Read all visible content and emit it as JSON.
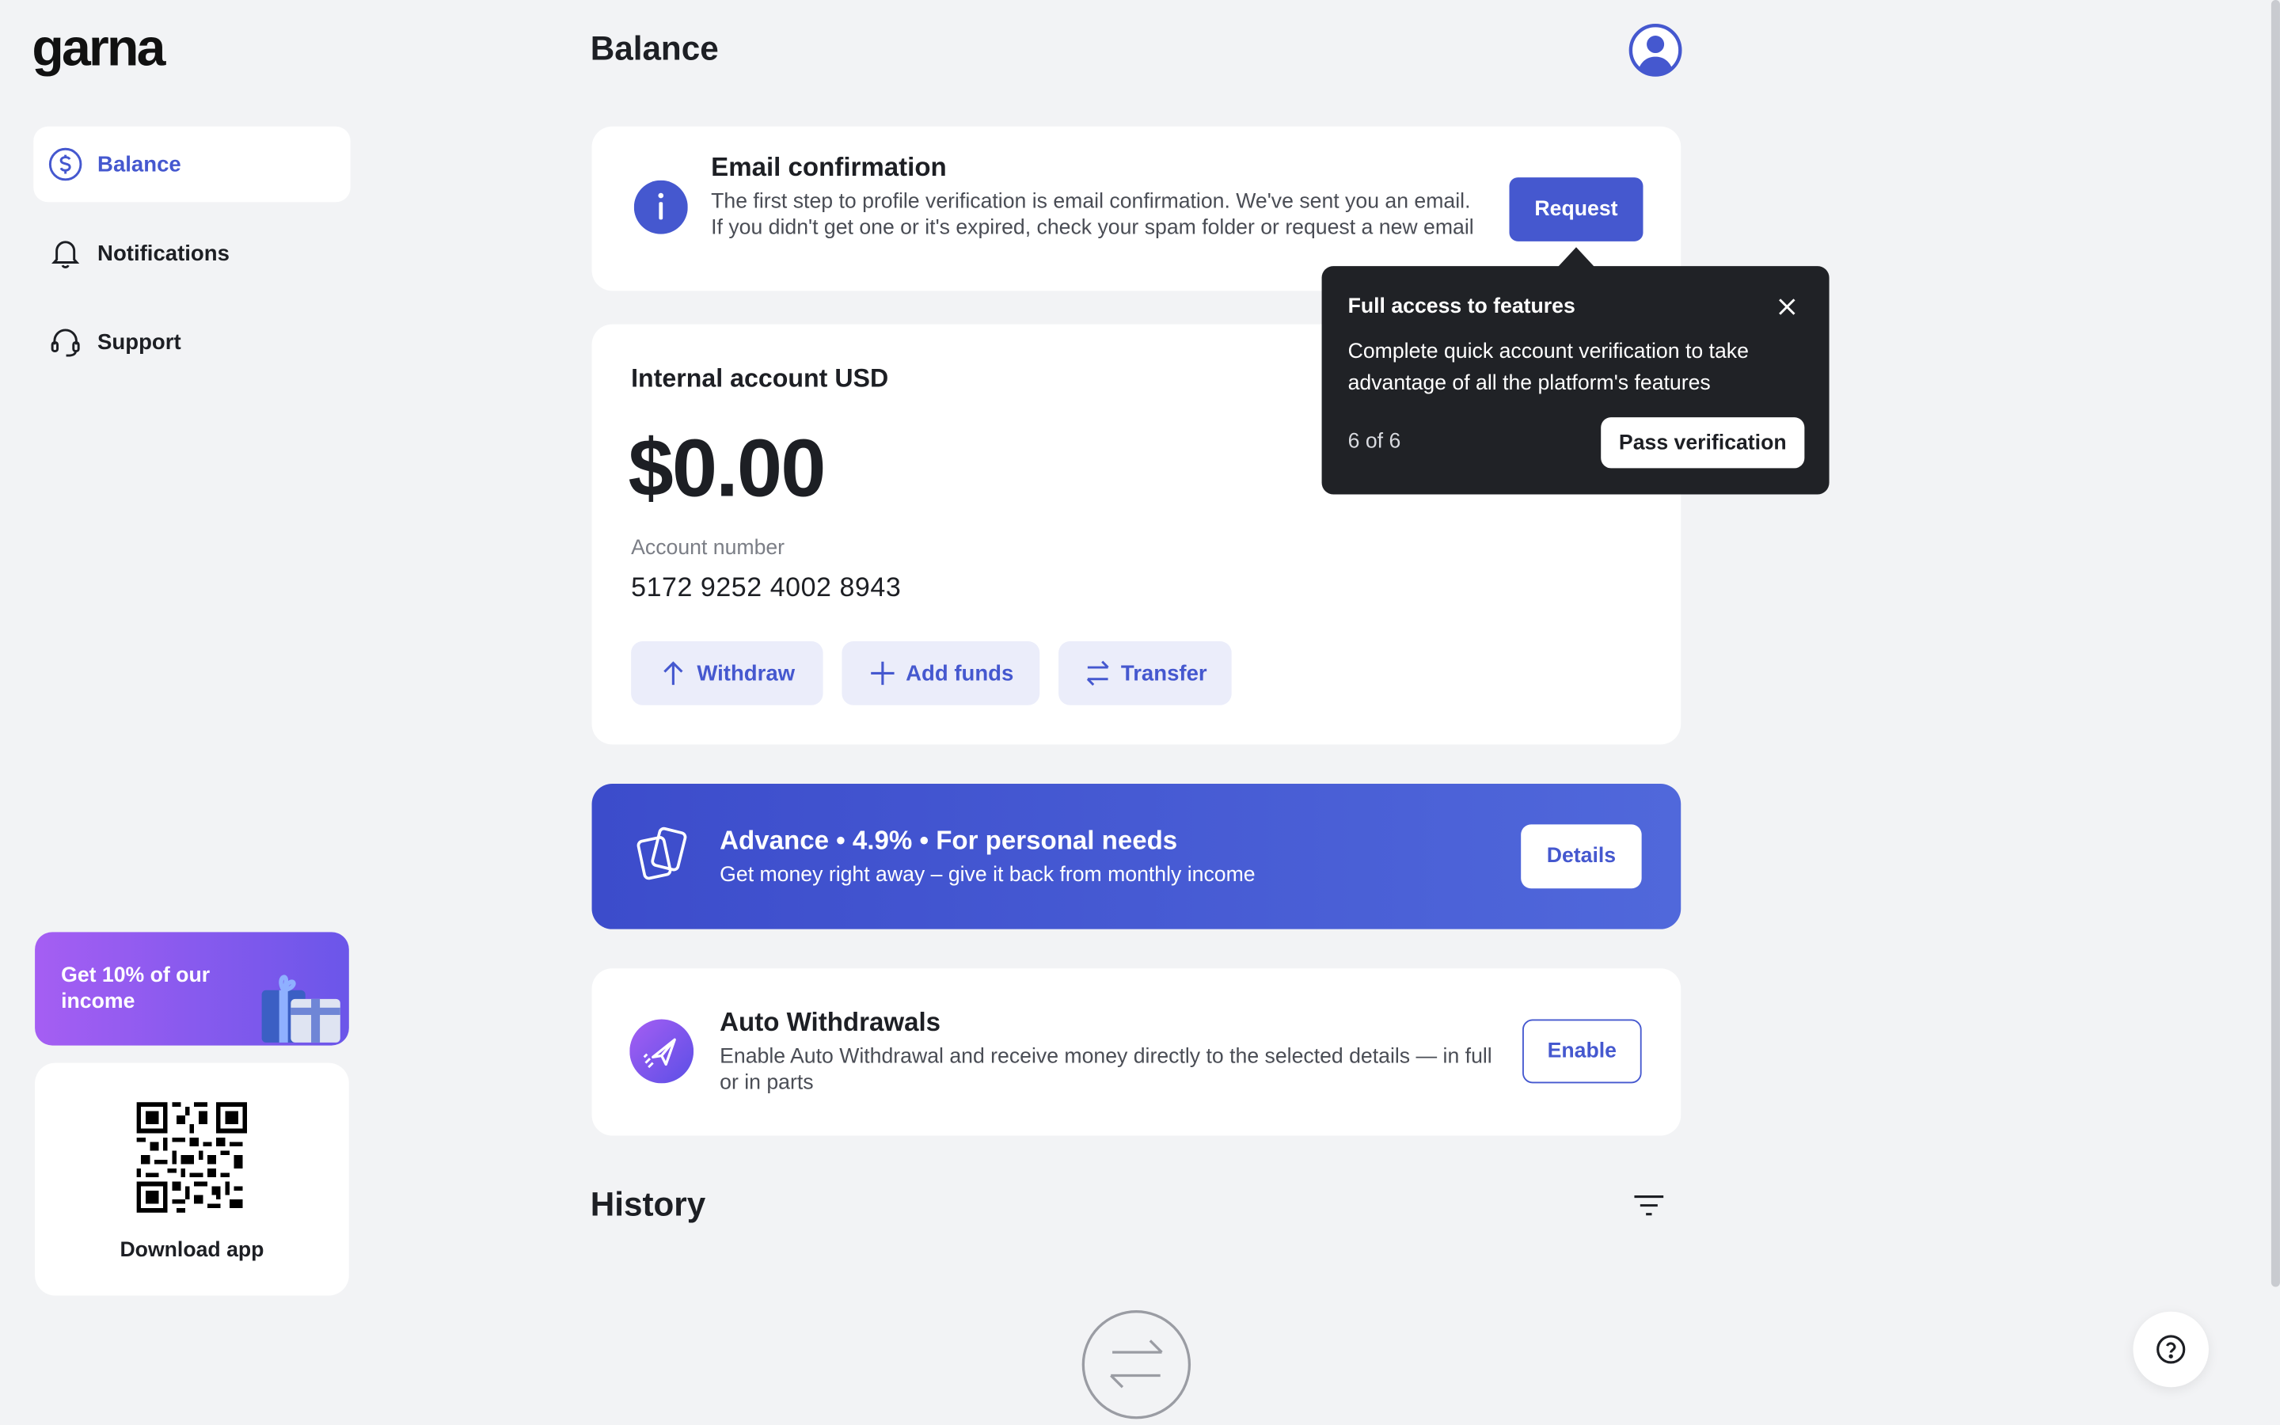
{
  "app": {
    "logo": "garna",
    "page_title": "Balance"
  },
  "sidebar": {
    "items": [
      {
        "label": "Balance",
        "icon": "dollar-circle-icon",
        "active": true
      },
      {
        "label": "Notifications",
        "icon": "bell-icon",
        "active": false
      },
      {
        "label": "Support",
        "icon": "headset-icon",
        "active": false
      }
    ],
    "promo": {
      "text": "Get 10% of our income",
      "icon": "gift-icon"
    },
    "download": {
      "label": "Download app",
      "icon": "qr-code-icon"
    }
  },
  "email_confirmation": {
    "title": "Email confirmation",
    "text": "The first step to profile verification is email confirmation. We've sent you an email. If you didn't get one or it's expired, check your spam folder or request a new email",
    "button": "Request",
    "icon": "info-icon"
  },
  "tooltip": {
    "title": "Full access to features",
    "text": "Complete quick account verification to take advantage of all the platform's features",
    "step": "6 of 6",
    "button": "Pass verification",
    "close_icon": "close-icon"
  },
  "account": {
    "title": "Internal account USD",
    "balance": "$0.00",
    "number_label": "Account number",
    "number": "5172 9252 4002 8943",
    "actions": [
      {
        "label": "Withdraw",
        "icon": "arrow-up-icon"
      },
      {
        "label": "Add funds",
        "icon": "plus-icon"
      },
      {
        "label": "Transfer",
        "icon": "transfer-icon"
      }
    ]
  },
  "advance": {
    "title": "Advance • 4.9% • For personal needs",
    "subtitle": "Get money right away – give it back from monthly income",
    "button": "Details",
    "icon": "cards-icon"
  },
  "auto_withdrawals": {
    "title": "Auto Withdrawals",
    "text": "Enable Auto Withdrawal and receive money directly to the selected details — in full or in parts",
    "button": "Enable",
    "icon": "send-icon"
  },
  "history": {
    "title": "History",
    "filter_icon": "filter-icon",
    "empty_icon": "transfer-arrows-icon"
  },
  "colors": {
    "accent": "#4558cf",
    "background": "#f2f3f5",
    "tooltip_bg": "#202226",
    "promo_start": "#a55ef3",
    "promo_end": "#6b56e9"
  }
}
